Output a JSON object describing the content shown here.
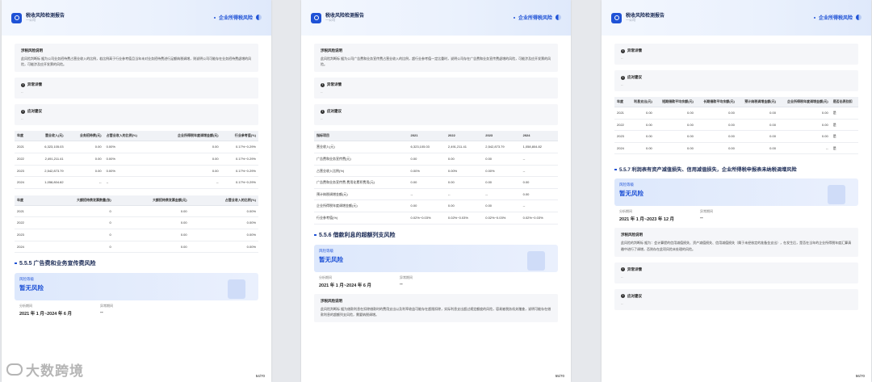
{
  "header": {
    "brand_title": "税收风险检测报告",
    "brand_sub": "一公司",
    "section": "企业所得税风险"
  },
  "p1": {
    "desc_title": "涉税风险说明",
    "desc_text": "此风险判断标 据为公司业务招待费占营业收入的比例，若比例高于行业参考值且当年未对业务招待费进行足额纳税调增，则说明公司可能存在业务招待费虚增的风险，可能涉及应开发票的风险。",
    "anomaly_title": "异常详情",
    "anomaly_val": "--",
    "advice_title": "应对建议",
    "advice_val": "--",
    "t1": {
      "headers": [
        "年度",
        "营业收入(元)",
        "业务招待费(元)",
        "占营业收入的比例(%)",
        "企业所得税年度调增金额(元)",
        "行业参考值(%)"
      ],
      "rows": [
        [
          "2021",
          "6,323,105.03",
          "0.00",
          "0.00%",
          "0.00",
          "0.17%~0.29%"
        ],
        [
          "2022",
          "2,491,211.41",
          "0.00",
          "0.00%",
          "0.00",
          "0.17%~0.29%"
        ],
        [
          "2023",
          "2,542,873.79",
          "0.00",
          "0.00%",
          "0.00",
          "0.17%~0.29%"
        ],
        [
          "2024",
          "1,058,804.82",
          "--",
          "--",
          "--",
          "0.17%~0.29%"
        ]
      ]
    },
    "t2": {
      "headers": [
        "年度",
        "大额招待费发票数量(张)",
        "大额招待费发票金额(元)",
        "占营业收入的比例(%)"
      ],
      "rows": [
        [
          "2021",
          "0",
          "0.00",
          "0.00%"
        ],
        [
          "2022",
          "0",
          "0.00",
          "0.00%"
        ],
        [
          "2023",
          "0",
          "0.00",
          "0.00%"
        ],
        [
          "2024",
          "0",
          "0.00",
          "0.00%"
        ]
      ]
    },
    "section": "5.5.5 广告费和业务宣传费风险",
    "risk_label": "风险等级",
    "risk_val": "暂无风险",
    "period_k": "分析期间",
    "period_v": "2021 年 1 月~2024 年 6 月",
    "abn_k": "异常期间",
    "abn_v": "--",
    "page": "54/70"
  },
  "p2": {
    "desc_title": "涉税风险说明",
    "desc_text": "此风险判断标 据为公司广告费和业务宣传费占营业收入的比例，超行业参考值一定比重时，说明公司存在广告费和业务宣传费虚增的风险，可能涉及应开发票的风险。",
    "anomaly_title": "异常详情",
    "anomaly_val": "--",
    "advice_title": "应对建议",
    "advice_val": "--",
    "t1": {
      "headers": [
        "指标项目",
        "2021",
        "2022",
        "2023",
        "2024"
      ],
      "rows": [
        [
          "营业收入(元)",
          "6,323,105.03",
          "2,491,211.41",
          "2,542,873.79",
          "1,058,804.82"
        ],
        [
          "广告费和业务宣传费(元)",
          "0.00",
          "0.00",
          "0.00",
          "--"
        ],
        [
          "占营业收入比例(%)",
          "0.00%",
          "0.00%",
          "0.00%",
          "--"
        ],
        [
          "广告费和业务宣传费-费用化累积费用(元)",
          "0.00",
          "0.00",
          "0.00",
          "0.00"
        ],
        [
          "预计纳税调增金额(元)",
          "--",
          "--",
          "--",
          "0.00"
        ],
        [
          "企业所得税年度调增金额(元)",
          "0.00",
          "0.00",
          "0.00",
          "--"
        ],
        [
          "行业参考值(%)",
          "0.02%~0.03%",
          "0.02%~0.03%",
          "0.02%~0.03%",
          "0.02%~0.03%"
        ]
      ]
    },
    "section": "5.5.6 借款利息的超额列支风险",
    "risk_label": "风险等级",
    "risk_val": "暂无风险",
    "period_k": "分析期间",
    "period_v": "2021 年 1 月~2024 年 6 月",
    "abn_k": "异常期间",
    "abn_v": "--",
    "desc2_title": "涉税风险说明",
    "desc2_text": "此风险判断标 据为借款利息在扣除借款时的费用支出以及利率收益可能存在超限扣除，实际利息支出超过规定额度的风险，容易被税务机关稽查，说明可能存在借款利息的超额列支风险，需要纳税调增。",
    "page": "55/70"
  },
  "p3": {
    "anomaly_title": "异常详情",
    "anomaly_val": "--",
    "advice_title": "应对建议",
    "advice_val": "--",
    "t1": {
      "headers": [
        "年度",
        "利息支出(元)",
        "短期借款平均余额(元)",
        "长期借款平均余额(元)",
        "预计纳税调增金额(元)",
        "企业所得税年度调增金额(元)",
        "是否出表别扣"
      ],
      "rows": [
        [
          "2021",
          "0.00",
          "0.00",
          "0.00",
          "0.00",
          "0.00",
          "是"
        ],
        [
          "2022",
          "0.00",
          "0.00",
          "0.00",
          "0.00",
          "0.00",
          "是"
        ],
        [
          "2023",
          "0.00",
          "0.00",
          "0.00",
          "0.00",
          "0.00",
          "是"
        ],
        [
          "2024",
          "0.00",
          "0.00",
          "0.00",
          "0.00",
          "--",
          "是"
        ]
      ]
    },
    "section": "5.5.7 利润表有资产减值损失、信用减值损失，企业所得税申报表未纳税调增风险",
    "risk_label": "风险等级",
    "risk_val": "暂无风险",
    "period_k": "分析期间",
    "period_v": "2021 年 1 月~2023 年 12 月",
    "abn_k": "异常期间",
    "abn_v": "--",
    "desc_title": "涉税风险说明",
    "desc_text": "此风险的判断标 据为：会计算提的信用减值损失、资产减值损失、信用减值损失（属于未经核定的准备金支出），在发生后，是否在当年的企业所得税年度汇算清缴中进行了调增，否则存在此项风险未处理的风险。",
    "anomaly2_title": "异常详情",
    "anomaly2_val": "--",
    "advice2_title": "应对建议",
    "advice2_val": "--",
    "page": "56/70"
  },
  "watermark": "大数跨境"
}
